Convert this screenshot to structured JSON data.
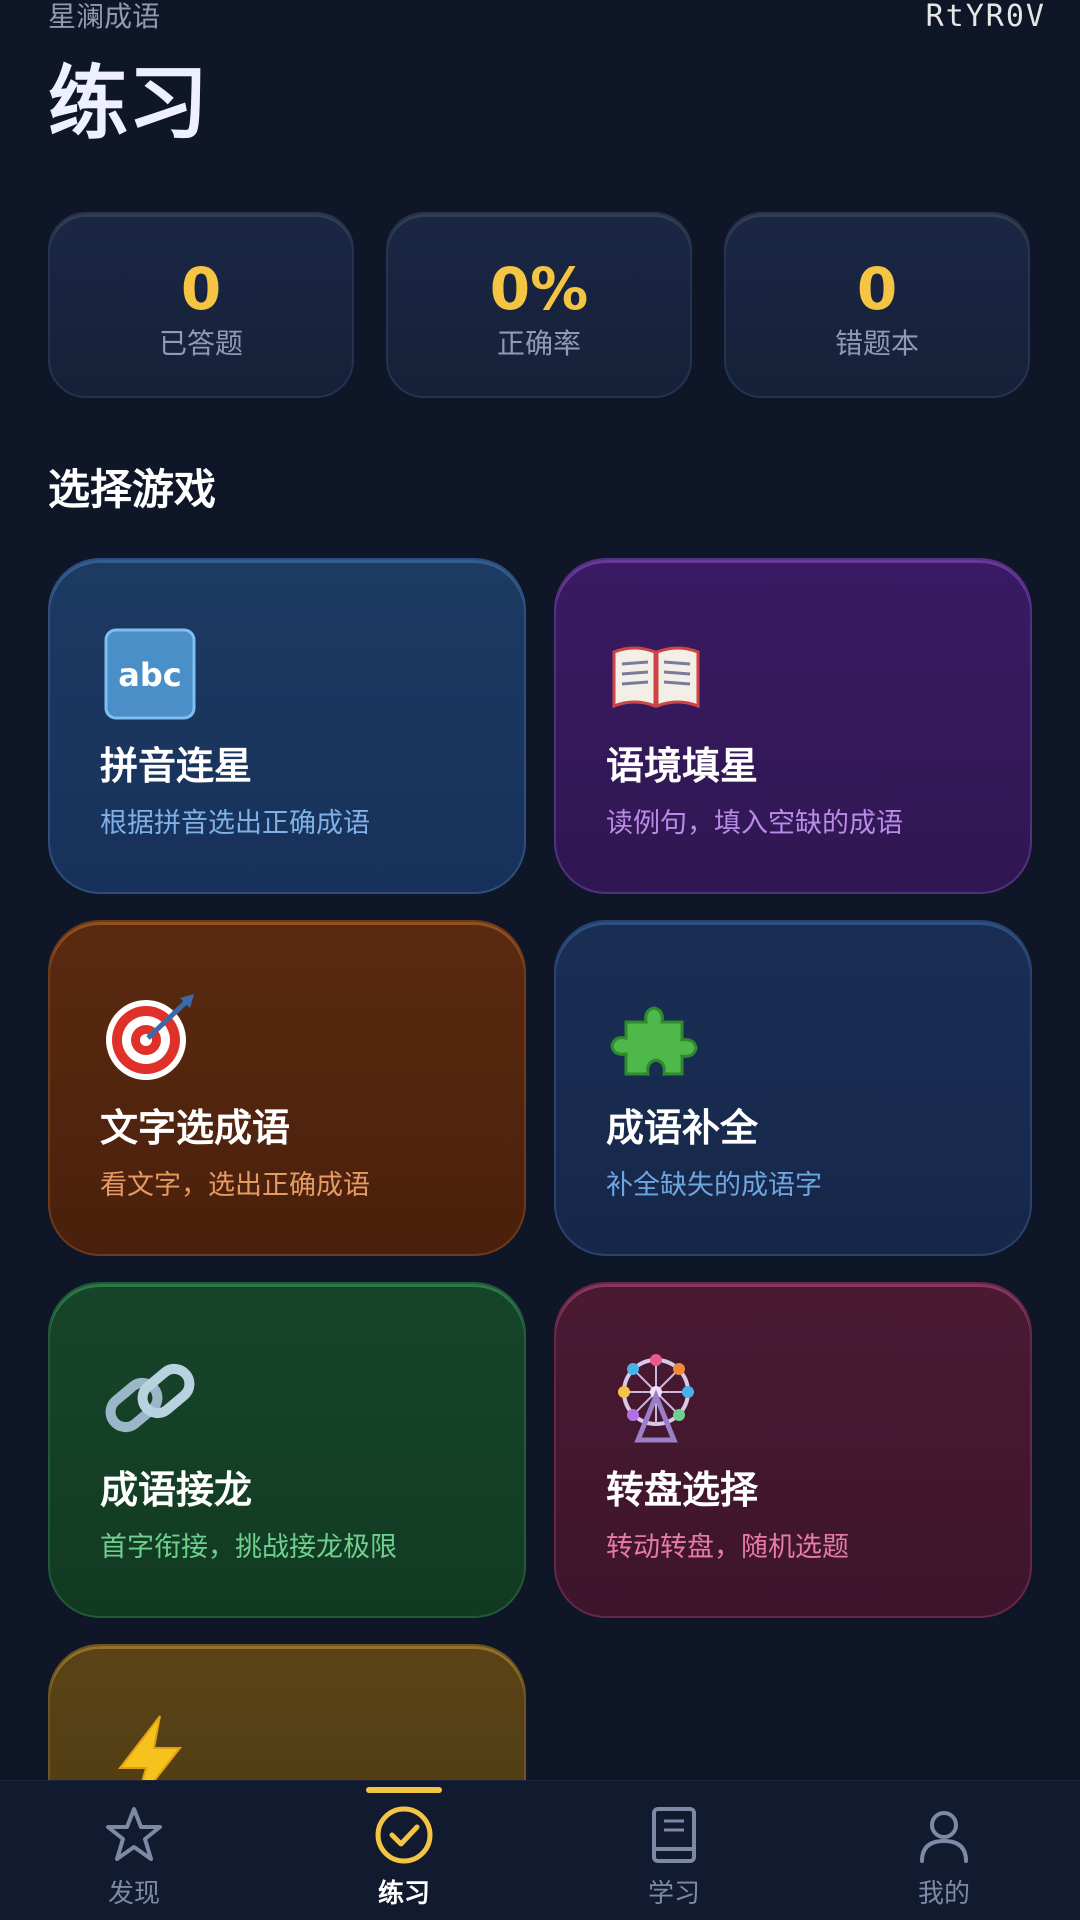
{
  "app_name": "星澜成语",
  "watermark": "RtYR0V",
  "page_title": "练习",
  "stats": [
    {
      "value": "0",
      "label": "已答题"
    },
    {
      "value": "0%",
      "label": "正确率"
    },
    {
      "value": "0",
      "label": "错题本"
    }
  ],
  "section_title": "选择游戏",
  "games": [
    {
      "icon": "abc-icon",
      "name": "拼音连星",
      "desc": "根据拼音选出正确成语",
      "color": "#2c4f7d"
    },
    {
      "icon": "open-book-icon",
      "name": "语境填星",
      "desc": "读例句，填入空缺的成语",
      "color": "#54307f"
    },
    {
      "icon": "target-icon",
      "name": "文字选成语",
      "desc": "看文字，选出正确成语",
      "color": "#6e3a1c"
    },
    {
      "icon": "puzzle-icon",
      "name": "成语补全",
      "desc": "补全缺失的成语字",
      "color": "#2a4270"
    },
    {
      "icon": "link-icon",
      "name": "成语接龙",
      "desc": "首字衔接，挑战接龙极限",
      "color": "#225a38"
    },
    {
      "icon": "ferris-wheel-icon",
      "name": "转盘选择",
      "desc": "转动转盘，随机选题",
      "color": "#66284a"
    },
    {
      "icon": "lightning-icon",
      "name": "",
      "desc": "",
      "color": "#6e5420"
    }
  ],
  "nav": [
    {
      "icon": "star-icon",
      "label": "发现",
      "active": false
    },
    {
      "icon": "check-circle-icon",
      "label": "练习",
      "active": true
    },
    {
      "icon": "book-icon",
      "label": "学习",
      "active": false
    },
    {
      "icon": "user-icon",
      "label": "我的",
      "active": false
    }
  ],
  "accent_color": "#f4c542"
}
